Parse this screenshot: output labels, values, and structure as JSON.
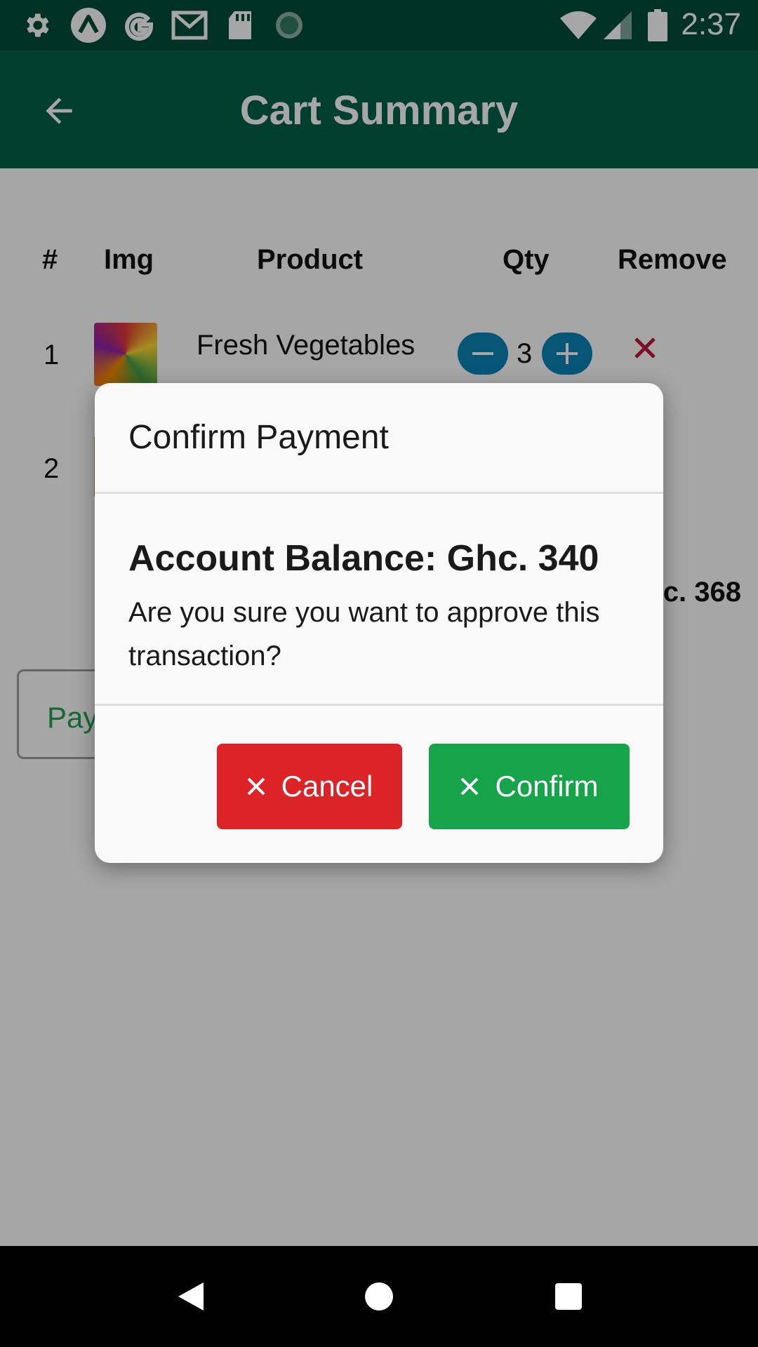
{
  "status_bar": {
    "time": "2:37",
    "icons": [
      "gear-icon",
      "expo-icon",
      "google-icon",
      "gmail-icon",
      "sd-card-icon",
      "sync-icon",
      "wifi-icon",
      "signal-icon",
      "battery-icon"
    ]
  },
  "app_bar": {
    "title": "Cart Summary",
    "back_icon": "arrow-back-icon"
  },
  "table": {
    "headers": [
      "#",
      "Img",
      "Product",
      "Qty",
      "Remove"
    ],
    "rows": [
      {
        "index": "1",
        "product": "Fresh Vegetables",
        "qty": "3"
      },
      {
        "index": "2"
      }
    ],
    "total_partial": "c. 368"
  },
  "pay_button": {
    "label": "Pay"
  },
  "dialog": {
    "title": "Confirm Payment",
    "balance": "Account Balance: Ghc. 340",
    "message": "Are you sure you want to approve this transaction?",
    "cancel_label": "Cancel",
    "confirm_label": "Confirm"
  },
  "colors": {
    "status_bar": "#004d36",
    "app_bar": "#006148",
    "qty_button": "#0b84b8",
    "cancel": "#dc2328",
    "confirm": "#17a34a",
    "remove": "#c0143c"
  }
}
